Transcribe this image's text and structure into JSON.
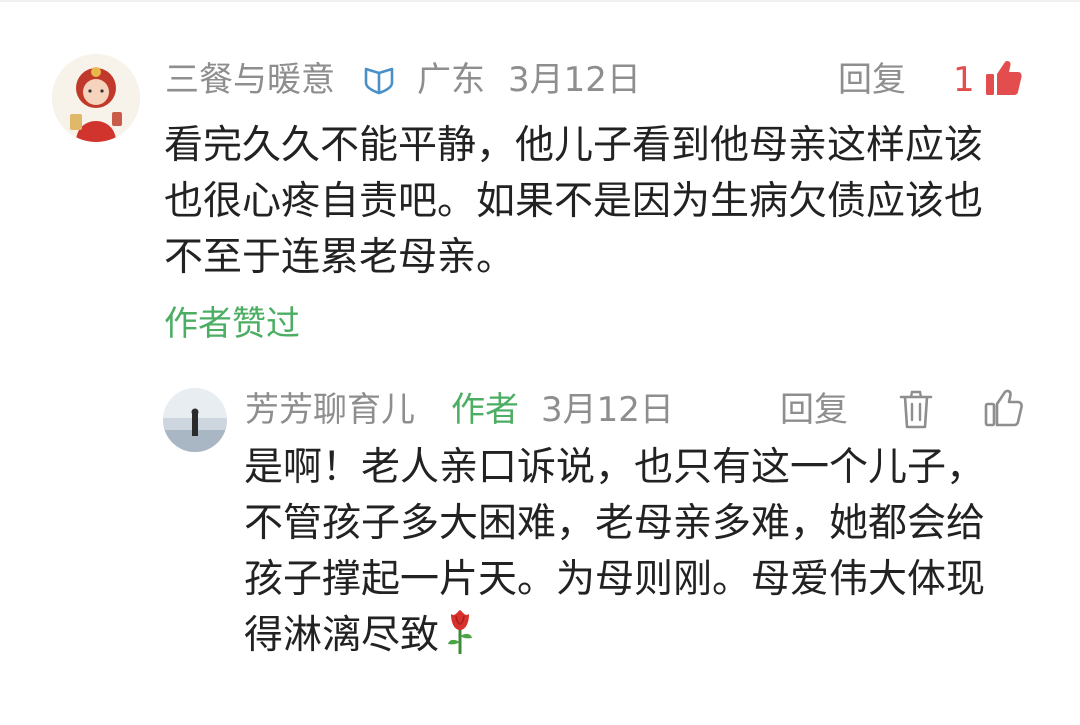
{
  "comments": [
    {
      "username": "三餐与暖意",
      "region": "广东",
      "date": "3月12日",
      "reply_label": "回复",
      "like_count": "1",
      "lines": [
        "看完久久不能平静，他儿子看到他母亲这样应该",
        "也很心疼自责吧。如果不是因为生病欠债应该也",
        "不至于连累老母亲。"
      ],
      "author_liked": "作者赞过",
      "icons": {
        "verified": "verified-shield-icon",
        "like": "thumbs-up-filled-icon"
      }
    }
  ],
  "reply": {
    "username": "芳芳聊育儿",
    "author_badge": "作者",
    "date": "3月12日",
    "reply_label": "回复",
    "lines": [
      "是啊！老人亲口诉说，也只有这一个儿子，",
      "不管孩子多大困难，老母亲多难，她都会给",
      "孩子撑起一片天。为母则刚。母爱伟大体现",
      "得淋漓尽致"
    ],
    "icons": {
      "delete": "trash-icon",
      "like": "thumbs-up-outline-icon",
      "emoji": "rose-icon"
    }
  },
  "colors": {
    "meta_gray": "#8e8e8e",
    "text": "#222222",
    "green": "#4cae63",
    "like_red": "#e44d4d"
  }
}
